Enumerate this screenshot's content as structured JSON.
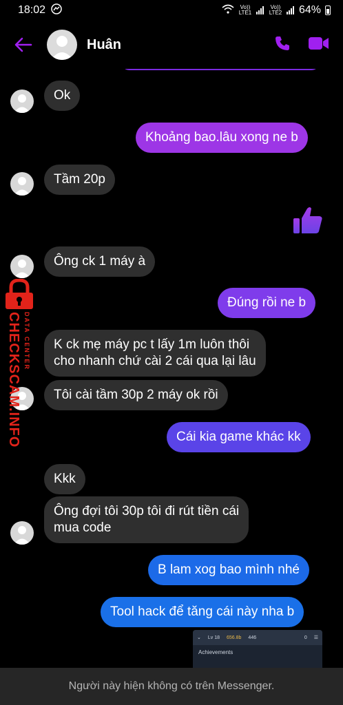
{
  "status_bar": {
    "time": "18:02",
    "sim1": "Vo)) LTE1",
    "sim2": "Vo)) LTE2",
    "battery": "64%"
  },
  "header": {
    "contact_name": "Huân",
    "accent_color": "#a020f0"
  },
  "messages": [
    {
      "side": "in",
      "text": "Ok"
    },
    {
      "side": "out",
      "text": "Khoảng bao.lâu xong ne b"
    },
    {
      "side": "in",
      "text": "Tầm 20p"
    },
    {
      "side": "out",
      "type": "like-icon"
    },
    {
      "side": "in",
      "text": "Ông ck 1 máy à"
    },
    {
      "side": "out",
      "text": "Đúng rồi ne b"
    },
    {
      "side": "in",
      "text": "K ck mẹ máy pc t lấy 1m luôn thôi"
    },
    {
      "side": "in",
      "text": "cho nhanh chứ cài 2 cái qua lại lâu"
    },
    {
      "side": "in",
      "text": "Tôi cài tầm 30p 2 máy ok rồi"
    },
    {
      "side": "out",
      "text": "Cái kia game khác kk"
    },
    {
      "side": "in",
      "text": "Kkk"
    },
    {
      "side": "in",
      "text": "Ông đợi tôi 30p tôi đi rút tiền cái"
    },
    {
      "side": "in",
      "text": "mua code"
    },
    {
      "side": "out",
      "text": "B lam xog bao mình nhé"
    },
    {
      "side": "out",
      "text": "Tool hack để tăng cái này nha b"
    }
  ],
  "thumbnail": {
    "level": "Lv 18",
    "gold": "656.8b",
    "gems": "446",
    "count": "0",
    "title": "Achievements"
  },
  "watermark": {
    "main": "CHECKSCAM.INFO",
    "sub": "DATA CENTER"
  },
  "footer": {
    "notice": "Người này hiện không có trên Messenger."
  }
}
